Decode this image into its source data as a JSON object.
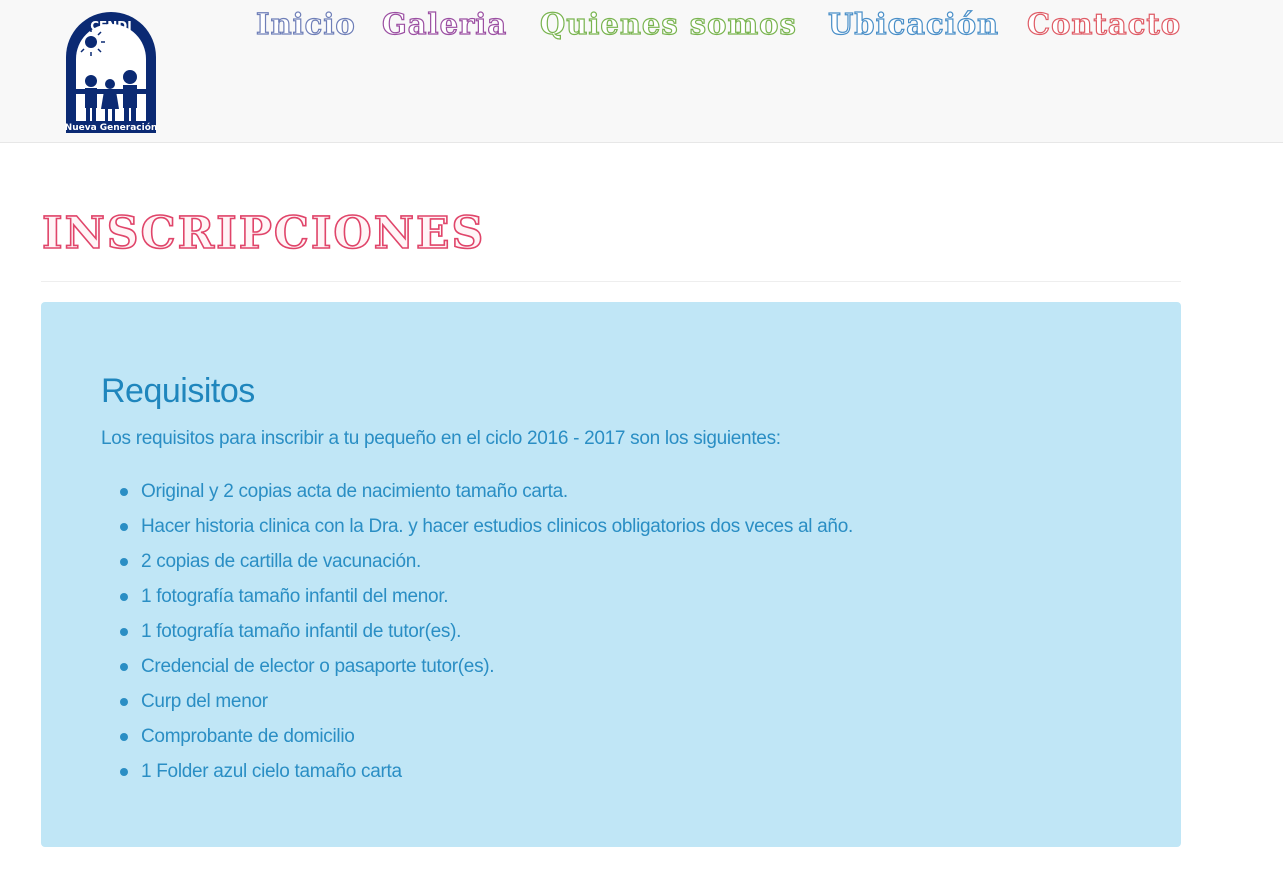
{
  "logo": {
    "top_text": "CENDI",
    "bottom_text": "Nueva Generación",
    "color": "#0b2a73"
  },
  "nav": {
    "items": [
      {
        "label": "Inicio",
        "color": "#6f7fb8"
      },
      {
        "label": "Galeria",
        "color": "#9b4fa2"
      },
      {
        "label": "Quienes somos",
        "color": "#79b44f"
      },
      {
        "label": "Ubicación",
        "color": "#4a8fc8"
      },
      {
        "label": "Contacto",
        "color": "#df5c66"
      }
    ]
  },
  "page": {
    "title": "INSCRIPCIONES",
    "title_color": "#e0456a"
  },
  "requisitos": {
    "heading": "Requisitos",
    "intro": "Los requisitos para inscribir a tu pequeño en el ciclo 2016 - 2017 son los siguientes:",
    "panel_color": "#c0e6f6",
    "text_color": "#2a8ec4",
    "items": [
      "Original y 2 copias acta de nacimiento tamaño carta.",
      "Hacer historia clinica con la Dra. y hacer estudios clinicos obligatorios dos veces al año.",
      "2 copias de cartilla de vacunación.",
      " 1 fotografía tamaño infantil del menor.",
      " 1 fotografía tamaño infantil de tutor(es).",
      "Credencial de elector o pasaporte tutor(es).",
      "Curp del menor",
      "Comprobante de domicilio",
      " 1 Folder azul cielo tamaño carta"
    ]
  }
}
